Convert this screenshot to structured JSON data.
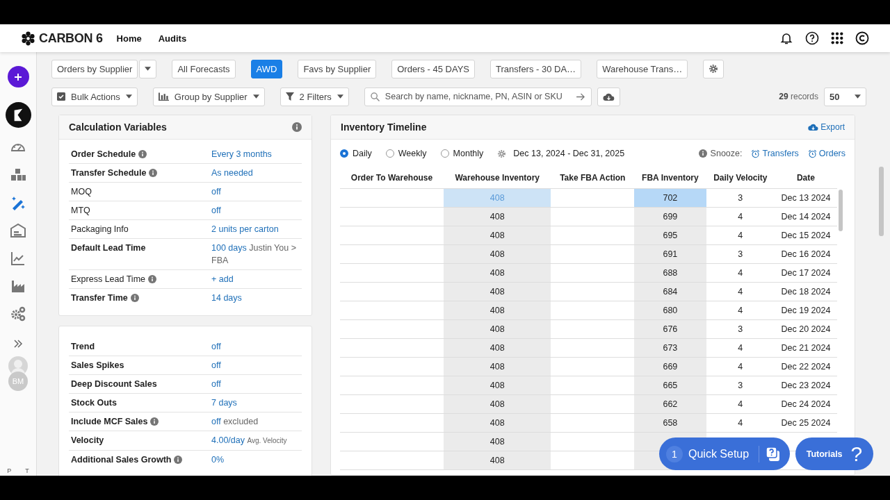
{
  "header": {
    "brand": "CARBON 6",
    "nav": [
      {
        "label": "Home"
      },
      {
        "label": "Audits"
      }
    ]
  },
  "sidebar": {
    "items": [
      {
        "selected": false
      },
      {
        "selected": false
      },
      {
        "selected": true
      },
      {
        "selected": false
      },
      {
        "selected": false
      },
      {
        "selected": false
      },
      {
        "selected": false
      }
    ],
    "user_initials": "BM",
    "footer": [
      "P",
      "T"
    ]
  },
  "view_tabs": [
    {
      "label": "Orders by Supplier",
      "selected": false,
      "dropdown": true
    },
    {
      "label": "All Forecasts",
      "selected": false,
      "dropdown": false
    },
    {
      "label": "AWD",
      "selected": true,
      "dropdown": false
    },
    {
      "label": "Favs by Supplier",
      "selected": false,
      "dropdown": false
    },
    {
      "label": "Orders - 45 DAYS",
      "selected": false,
      "dropdown": false
    },
    {
      "label": "Transfers - 30 DA…",
      "selected": false,
      "dropdown": false
    },
    {
      "label": "Warehouse Trans…",
      "selected": false,
      "dropdown": false
    }
  ],
  "toolbar": {
    "bulk_actions": "Bulk Actions",
    "group_by": "Group by Supplier",
    "filters": "2 Filters",
    "search": {
      "placeholder": "Search by name, nickname, PN, ASIN or SKU"
    },
    "records_count": "29",
    "records_label": "records",
    "page_size": "50"
  },
  "calculation_variables": {
    "title": "Calculation Variables",
    "groups": [
      [
        {
          "label": "Order Schedule",
          "bold": true,
          "info": true,
          "value": "Every 3 months"
        },
        {
          "label": "Transfer Schedule",
          "bold": true,
          "info": true,
          "value": "As needed"
        },
        {
          "label": "MOQ",
          "bold": false,
          "info": false,
          "value": "off"
        },
        {
          "label": "MTQ",
          "bold": false,
          "info": false,
          "value": "off"
        },
        {
          "label": "Packaging Info",
          "bold": false,
          "info": false,
          "value": "2 units per carton"
        },
        {
          "label": "Default Lead Time",
          "bold": true,
          "info": false,
          "value": "100 days",
          "note": "Justin You > FBA"
        },
        {
          "label": "Express Lead Time",
          "bold": false,
          "info": true,
          "value": "+ add"
        },
        {
          "label": "Transfer Time",
          "bold": true,
          "info": true,
          "value": "14 days"
        }
      ],
      [
        {
          "label": "Trend",
          "bold": true,
          "info": false,
          "value": "off"
        },
        {
          "label": "Sales Spikes",
          "bold": true,
          "info": false,
          "value": "off"
        },
        {
          "label": "Deep Discount Sales",
          "bold": true,
          "info": false,
          "value": "off"
        },
        {
          "label": "Stock Outs",
          "bold": true,
          "info": false,
          "value": "7 days"
        },
        {
          "label": "Include MCF Sales",
          "bold": true,
          "info": true,
          "value": "off",
          "note": "excluded"
        },
        {
          "label": "Velocity",
          "bold": true,
          "info": false,
          "value": "4.00/day",
          "small_note": "Avg. Velocity"
        },
        {
          "label": "Additional Sales Growth",
          "bold": true,
          "info": true,
          "value": "0%"
        }
      ]
    ]
  },
  "inventory_timeline": {
    "title": "Inventory Timeline",
    "export": "Export",
    "periods": [
      {
        "label": "Daily",
        "selected": true
      },
      {
        "label": "Weekly",
        "selected": false
      },
      {
        "label": "Monthly",
        "selected": false
      }
    ],
    "date_range": "Dec 13, 2024 - Dec 31, 2025",
    "snooze_label": "Snooze:",
    "snooze_links": [
      "Transfers",
      "Orders"
    ],
    "columns": [
      "Order To Warehouse",
      "Warehouse Inventory",
      "Take FBA Action",
      "FBA Inventory",
      "Daily Velocity",
      "Date"
    ],
    "rows": [
      {
        "selected": true,
        "cells": [
          "",
          "408",
          "",
          "702",
          "3",
          "Dec 13 2024"
        ]
      },
      {
        "selected": false,
        "cells": [
          "",
          "408",
          "",
          "699",
          "4",
          "Dec 14 2024"
        ]
      },
      {
        "selected": false,
        "cells": [
          "",
          "408",
          "",
          "695",
          "4",
          "Dec 15 2024"
        ]
      },
      {
        "selected": false,
        "cells": [
          "",
          "408",
          "",
          "691",
          "3",
          "Dec 16 2024"
        ]
      },
      {
        "selected": false,
        "cells": [
          "",
          "408",
          "",
          "688",
          "4",
          "Dec 17 2024"
        ]
      },
      {
        "selected": false,
        "cells": [
          "",
          "408",
          "",
          "684",
          "4",
          "Dec 18 2024"
        ]
      },
      {
        "selected": false,
        "cells": [
          "",
          "408",
          "",
          "680",
          "4",
          "Dec 19 2024"
        ]
      },
      {
        "selected": false,
        "cells": [
          "",
          "408",
          "",
          "676",
          "3",
          "Dec 20 2024"
        ]
      },
      {
        "selected": false,
        "cells": [
          "",
          "408",
          "",
          "673",
          "4",
          "Dec 21 2024"
        ]
      },
      {
        "selected": false,
        "cells": [
          "",
          "408",
          "",
          "669",
          "4",
          "Dec 22 2024"
        ]
      },
      {
        "selected": false,
        "cells": [
          "",
          "408",
          "",
          "665",
          "3",
          "Dec 23 2024"
        ]
      },
      {
        "selected": false,
        "cells": [
          "",
          "408",
          "",
          "662",
          "4",
          "Dec 24 2024"
        ]
      },
      {
        "selected": false,
        "cells": [
          "",
          "408",
          "",
          "658",
          "4",
          "Dec 25 2024"
        ]
      },
      {
        "selected": false,
        "cells": [
          "",
          "408",
          "",
          "",
          "",
          ""
        ]
      },
      {
        "selected": false,
        "cells": [
          "",
          "408",
          "",
          "",
          "",
          ""
        ]
      }
    ]
  },
  "help": {
    "quick_setup_count": "1",
    "quick_setup": "Quick Setup",
    "tutorials": "Tutorials",
    "tutorials_glyph": "?"
  }
}
